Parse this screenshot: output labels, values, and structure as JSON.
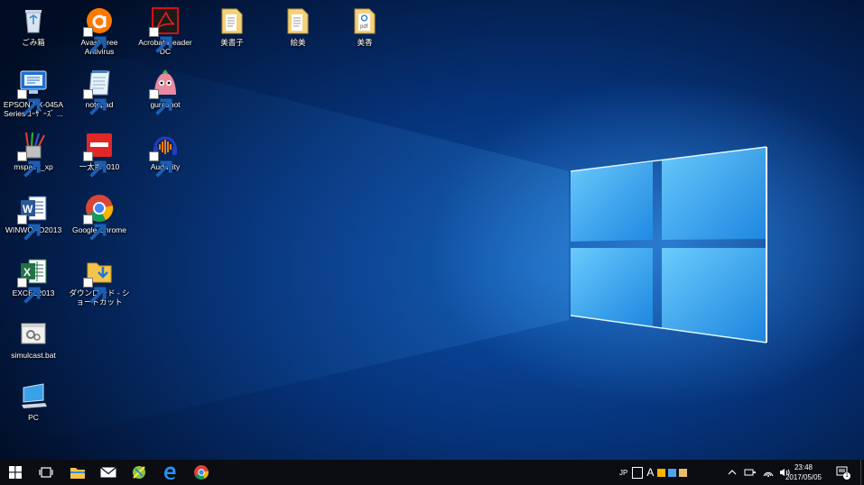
{
  "desktop": {
    "icons": [
      {
        "label": "ごみ箱"
      },
      {
        "label": "Avast Free Antivirus"
      },
      {
        "label": "Acrobat Reader DC"
      },
      {
        "label": "美書子"
      },
      {
        "label": "絵美"
      },
      {
        "label": "美香"
      },
      {
        "label": "EPSON PX-045A Series ﾕｰｻﾞｰｽﾞ ..."
      },
      {
        "label": "notepad"
      },
      {
        "label": "gurashot"
      },
      {
        "label": "mspaint_xp"
      },
      {
        "label": "一太郎2010"
      },
      {
        "label": "Audacity"
      },
      {
        "label": "WINWORD2013"
      },
      {
        "label": "Google Chrome"
      },
      {
        "label": "EXCEL2013"
      },
      {
        "label": "ダウンロード - ショートカット"
      },
      {
        "label": "simulcast.bat"
      },
      {
        "label": "PC"
      }
    ]
  },
  "taskbar": {
    "pinned": [
      "start-icon",
      "task-view-icon",
      "file-explorer-icon",
      "mail-icon",
      "app-icon",
      "edge-icon",
      "chrome-icon"
    ],
    "tray": {
      "ime_lang": "JP",
      "ime_mode": "A",
      "time": "23:48",
      "date": "2017/05/05",
      "notification_count": "1"
    }
  },
  "colors": {
    "taskbar": "#0b0d12",
    "wallpaper_dark": "#031b45",
    "wallpaper_glow": "#46aaff"
  }
}
